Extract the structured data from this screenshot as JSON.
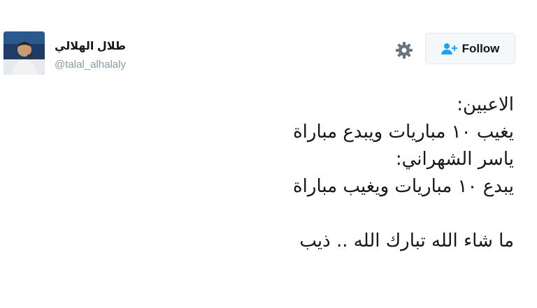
{
  "author": {
    "display_name": "طلال الهلالي",
    "handle": "@talal_alhalaly",
    "avatar_icon": "user-avatar-photo"
  },
  "actions": {
    "settings_icon": "gear-icon",
    "follow_label": "Follow",
    "follow_icon": "person-add-icon"
  },
  "tweet": {
    "lines": [
      "الاعبين:",
      "يغيب ١٠ مباريات ويبدع مباراة",
      "ياسر الشهراني:",
      "يبدع ١٠ مباريات ويغيب مباراة",
      "",
      "ما شاء الله تبارك الله .. ذيب"
    ]
  },
  "colors": {
    "text": "#14171a",
    "secondary": "#8899a6",
    "accent": "#1da1f2",
    "button_bg": "#f5f8fa",
    "button_border": "#e1e8ed"
  }
}
